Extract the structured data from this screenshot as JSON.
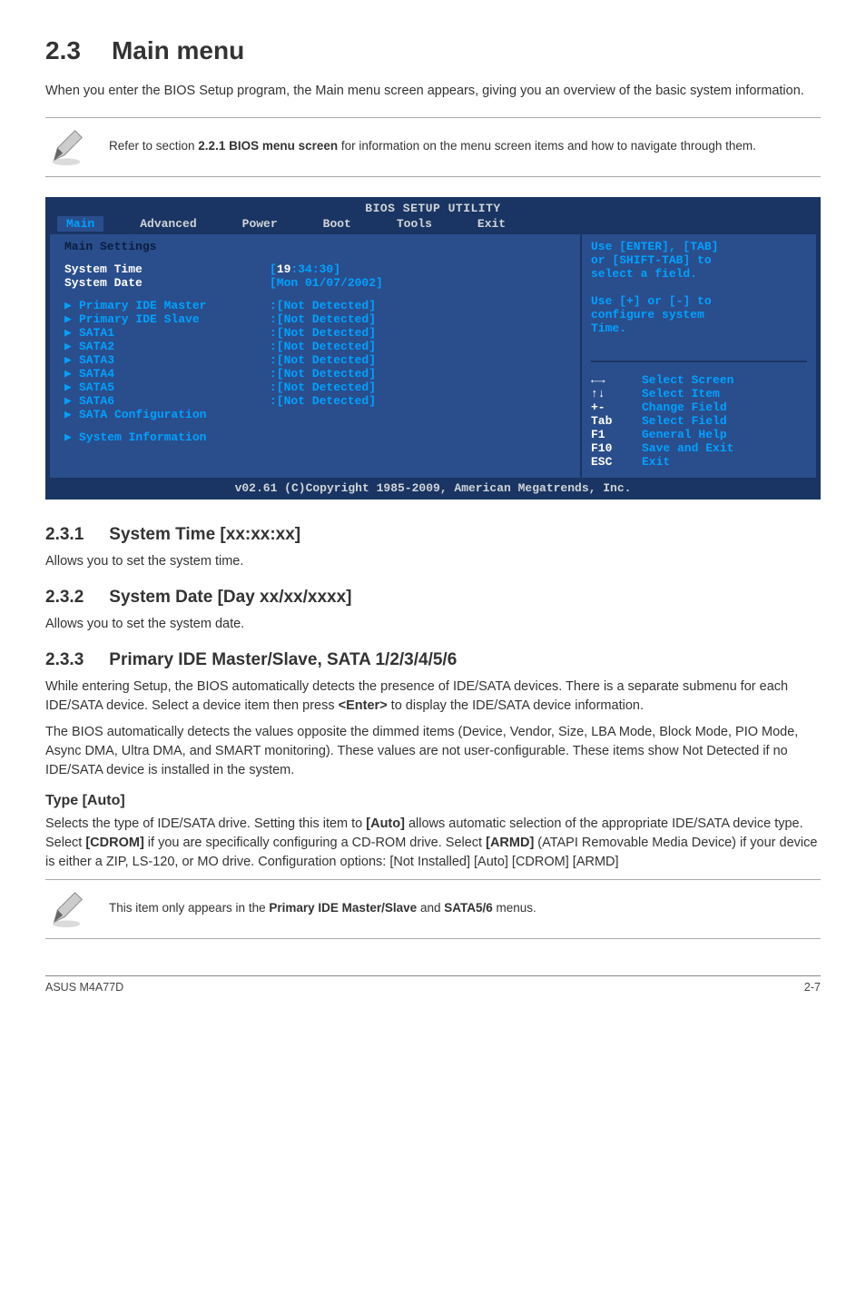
{
  "h1": {
    "num": "2.3",
    "title": "Main menu"
  },
  "intro": "When you enter the BIOS Setup program, the Main menu screen appears, giving you an overview of the basic system information.",
  "callout1": "Refer to section 2.2.1 BIOS menu screen for information on the menu screen items and how to navigate through them.",
  "callout1_bold": "2.2.1 BIOS menu screen",
  "bios": {
    "title": "BIOS SETUP UTILITY",
    "tabs": [
      "Main",
      "Advanced",
      "Power",
      "Boot",
      "Tools",
      "Exit"
    ],
    "main_settings_label": "Main Settings",
    "system_time_label": "System Time",
    "system_time_value_prefix": "[",
    "system_time_hour": "19",
    "system_time_rest": ":34:30]",
    "system_date_label": "System Date",
    "system_date_value": "[Mon 01/07/2002]",
    "items": [
      {
        "label": "Primary IDE Master",
        "value": ":[Not Detected]"
      },
      {
        "label": "Primary IDE Slave",
        "value": ":[Not Detected]"
      },
      {
        "label": "SATA1",
        "value": ":[Not Detected]"
      },
      {
        "label": "SATA2",
        "value": ":[Not Detected]"
      },
      {
        "label": "SATA3",
        "value": ":[Not Detected]"
      },
      {
        "label": "SATA4",
        "value": ":[Not Detected]"
      },
      {
        "label": "SATA5",
        "value": ":[Not Detected]"
      },
      {
        "label": "SATA6",
        "value": ":[Not Detected]"
      }
    ],
    "sata_config": "SATA Configuration",
    "sys_info": "System Information",
    "help_top": [
      "Use [ENTER], [TAB]",
      "or [SHIFT-TAB] to",
      "select a field.",
      "",
      "Use [+] or [-] to",
      "configure system",
      "Time."
    ],
    "keys": [
      {
        "k": "←→",
        "d": "Select Screen",
        "arrow": true
      },
      {
        "k": "↑↓",
        "d": "Select Item",
        "arrow": true
      },
      {
        "k": "+-",
        "d": "Change Field"
      },
      {
        "k": "Tab",
        "d": "Select Field"
      },
      {
        "k": "F1",
        "d": "General Help"
      },
      {
        "k": "F10",
        "d": "Save and Exit"
      },
      {
        "k": "ESC",
        "d": "Exit"
      }
    ],
    "footer": "v02.61 (C)Copyright 1985-2009, American Megatrends, Inc."
  },
  "s231": {
    "num": "2.3.1",
    "title": "System Time [xx:xx:xx]",
    "body": "Allows you to set the system time."
  },
  "s232": {
    "num": "2.3.2",
    "title": "System Date [Day xx/xx/xxxx]",
    "body": "Allows you to set the system date."
  },
  "s233": {
    "num": "2.3.3",
    "title": "Primary IDE Master/Slave, SATA 1/2/3/4/5/6",
    "p1": "While entering Setup, the BIOS automatically detects the presence of IDE/SATA devices. There is a separate submenu for each IDE/SATA device. Select a device item then press <Enter> to display the IDE/SATA device information.",
    "p2": "The BIOS automatically detects the values opposite the dimmed items (Device, Vendor, Size, LBA Mode, Block Mode, PIO Mode, Async DMA, Ultra DMA, and SMART monitoring). These values are not user-configurable. These items show Not Detected if no IDE/SATA device is installed in the system."
  },
  "type": {
    "heading": "Type [Auto]",
    "body": "Selects the type of IDE/SATA drive. Setting this item to [Auto] allows automatic selection of the appropriate IDE/SATA device type. Select [CDROM] if you are specifically configuring a CD-ROM drive. Select [ARMD] (ATAPI Removable Media Device) if your device is either a ZIP, LS-120, or MO drive. Configuration options: [Not Installed] [Auto] [CDROM] [ARMD]"
  },
  "callout2": "This item only appears in the Primary IDE Master/Slave and SATA5/6 menus.",
  "footer": {
    "left": "ASUS M4A77D",
    "right": "2-7"
  }
}
